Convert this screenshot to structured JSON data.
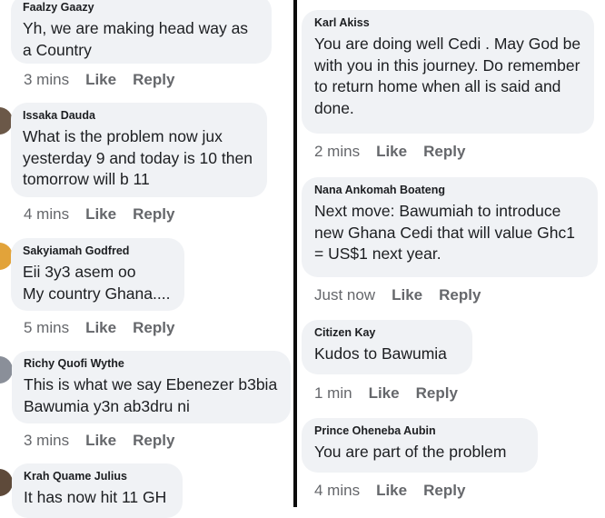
{
  "left_comments": [
    {
      "author": "Faalzy Gaazy",
      "text": "Yh, we are making head way as a Country",
      "time": "3 mins"
    },
    {
      "author": "Issaka Dauda",
      "text": "What is the problem now jux yesterday 9 and today is 10 then tomorrow will b 11",
      "time": "4 mins"
    },
    {
      "author": "Sakyiamah Godfred",
      "text": "Eii 3y3 asem oo\nMy country Ghana....",
      "time": "5 mins"
    },
    {
      "author": "Richy Quofi Wythe",
      "text": "This is what we say Ebenezer b3bia Bawumia y3n ab3dru ni",
      "time": "3 mins"
    },
    {
      "author": "Krah Quame Julius",
      "text": "It has now hit 11 GH",
      "time": ""
    }
  ],
  "right_comments": [
    {
      "author": "Karl Akiss",
      "text": "You are doing well Cedi . May God be with you in this journey. Do remember to return home when all is said and done.",
      "time": "2 mins"
    },
    {
      "author": "Nana Ankomah Boateng",
      "text": "Next move: Bawumiah to introduce new Ghana Cedi that will value Ghc1 =  US$1 next year.",
      "time": "Just now"
    },
    {
      "author": "Citizen Kay",
      "text": "Kudos to Bawumia",
      "time": "1 min"
    },
    {
      "author": "Prince Oheneba Aubin",
      "text": "You are part of the problem",
      "time": "4 mins"
    }
  ],
  "actions": {
    "like": "Like",
    "reply": "Reply"
  }
}
